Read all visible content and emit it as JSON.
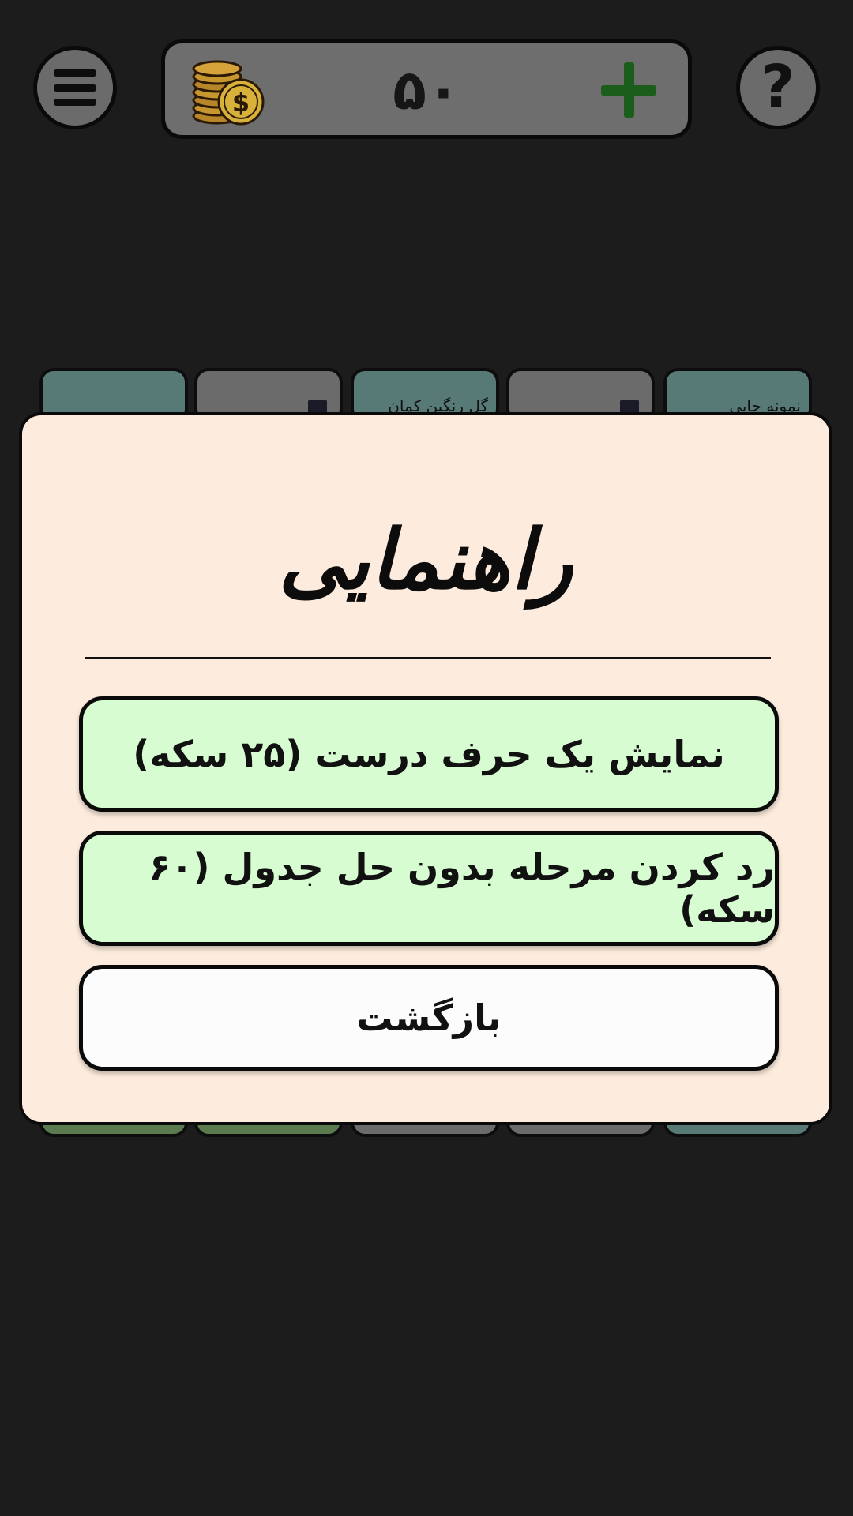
{
  "header": {
    "coin_count": "۵۰",
    "menu_icon": "hamburger-menu-icon",
    "help_label": "?",
    "coins_icon": "coin-stack-icon",
    "add_icon": "plus-icon",
    "add_color": "#1b5e1b"
  },
  "levels": {
    "top_row": [
      {
        "label": ""
      },
      {
        "label": "",
        "locked": true
      },
      {
        "label": "گل رنگین کمان"
      },
      {
        "label": "",
        "locked": true
      },
      {
        "label": "نمونه جایی"
      }
    ]
  },
  "dialog": {
    "title": "راهنمایی",
    "reveal_letter_label": "نمایش یک حرف درست (۲۵ سکه)",
    "skip_level_label": "رد کردن مرحله بدون حل جدول (۶۰ سکه)",
    "back_label": "بازگشت"
  },
  "colors": {
    "background": "#1c1c1c",
    "dialog_bg": "#fdecdd",
    "hint_button_bg": "#d7fcd1",
    "back_button_bg": "#fcfcfc"
  }
}
